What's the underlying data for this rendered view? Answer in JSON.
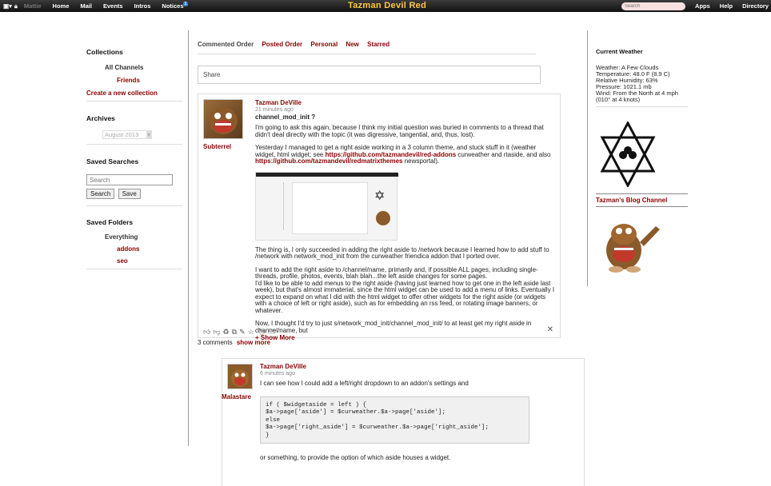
{
  "topbar": {
    "user": "Mattie",
    "nav": [
      "Home",
      "Mail",
      "Events",
      "Intros",
      "Notices"
    ],
    "notice_count": "1",
    "site_name": "Tazman Devil Red",
    "search_placeholder": "Search",
    "right_nav": [
      "Apps",
      "Help",
      "Directory"
    ]
  },
  "left": {
    "collections_title": "Collections",
    "all_channels": "All Channels",
    "friends": "Friends",
    "create_collection": "Create a new collection",
    "archives_title": "Archives",
    "archive_select": "August 2013",
    "saved_searches_title": "Saved Searches",
    "search_placeholder": "Search",
    "search_button": "Search",
    "save_button": "Save",
    "saved_folders_title": "Saved Folders",
    "everything": "Everything",
    "folders": [
      "addons",
      "seo"
    ]
  },
  "tabs": [
    "Commented Order",
    "Posted Order",
    "Personal",
    "New",
    "Starred"
  ],
  "share_placeholder": "Share",
  "post": {
    "author": "Tazman DeVille",
    "time": "21 minutes ago",
    "title": "channel_mod_init ?",
    "avatar_caption": "Subterrel",
    "p1": "I'm going to ask this again, because I think my initial question was buried in comments to a thread that didn't deal directly with the topic (it was digressive, tangential, and, thus, lost).",
    "p2a": "Yesterday I managed to get a right aside working in a 3 column theme, and stuck stuff in it (weather widget, html widget; see ",
    "link1": "https://github.com/tazmandevil/red-addons",
    "p2b": " curweather and rtaside, and also ",
    "link2": "https://github.com/tazmandevil/redmatrixthemes",
    "p2c": " newsportal).",
    "p3": "The thing is, I only succeeded in adding the right aside to /network because I learned how to add stuff to /network with network_mod_init from the curweather friendica addon that I ported over.",
    "p4": "I want to add the right aside to /channel/name, primarily and, if possible ALL pages, including single-threads, profile, photos, events, blah blah...the left aside changes for some pages.",
    "p5": "I'd like to be able to add menus to the right aside (having just learned how to get one in the left aside last week), but that's almost immaterial, since the html widget can be used to add a menu of links. Eventually I expect to expand on what I did with the html widget to offer other widgets for the right aside (or widgets with a choice of left or right aside), such as for embedding an rss feed, or rotating image banners, or whatever.",
    "p6": "Now, I thought I'd try to just s/network_mod_init/channel_mod_init/ to at least get my right aside in channel/name, but",
    "show_more": "+ Show More",
    "comments_count": "3 comments",
    "show_all": "show more"
  },
  "comment": {
    "author": "Tazman DeVille",
    "time": "6 minutes ago",
    "avatar_caption": "Malastare",
    "text1": "I can see how I could add a left/right dropdown to an addon's settings and",
    "code": [
      "if ( $widgetaside = left ) {",
      "$a->page['aside'] = $curweather.$a->page['aside'];",
      "else",
      "$a->page['right_aside'] = $curweather.$a->page['right_aside'];",
      "}"
    ],
    "text2": "or something, to provide the option of which aside houses a widget."
  },
  "right": {
    "weather_title": "Current Weather",
    "weather_lines": [
      "Weather: A Few Clouds",
      "Temperature: 48.0 F (8.9 C)",
      "Relative Humidity: 63%",
      "Pressure: 1021.1 mb",
      "Wind: From the North at 4 mph",
      "(010° at 4 knots)"
    ],
    "blog_channel": "Tazman's Blog Channel"
  }
}
